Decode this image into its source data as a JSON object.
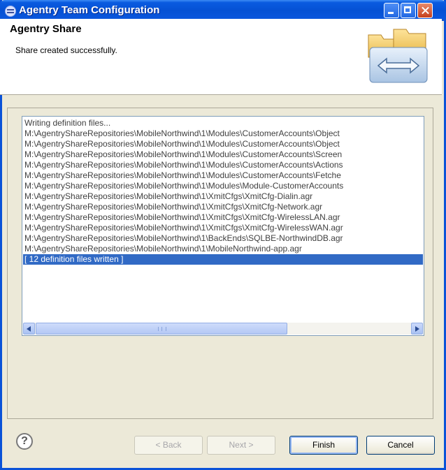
{
  "window": {
    "title": "Agentry Team Configuration"
  },
  "header": {
    "title": "Agentry Share",
    "message": "Share created successfully.",
    "banner_icon": "folders-transfer-icon"
  },
  "log": {
    "lines": [
      "Writing definition files...",
      "M:\\AgentryShareRepositories\\MobileNorthwind\\1\\Modules\\CustomerAccounts\\Object",
      "M:\\AgentryShareRepositories\\MobileNorthwind\\1\\Modules\\CustomerAccounts\\Object",
      "M:\\AgentryShareRepositories\\MobileNorthwind\\1\\Modules\\CustomerAccounts\\Screen",
      "M:\\AgentryShareRepositories\\MobileNorthwind\\1\\Modules\\CustomerAccounts\\Actions",
      "M:\\AgentryShareRepositories\\MobileNorthwind\\1\\Modules\\CustomerAccounts\\Fetche",
      "M:\\AgentryShareRepositories\\MobileNorthwind\\1\\Modules\\Module-CustomerAccounts",
      "M:\\AgentryShareRepositories\\MobileNorthwind\\1\\XmitCfgs\\XmitCfg-Dialin.agr",
      "M:\\AgentryShareRepositories\\MobileNorthwind\\1\\XmitCfgs\\XmitCfg-Network.agr",
      "M:\\AgentryShareRepositories\\MobileNorthwind\\1\\XmitCfgs\\XmitCfg-WirelessLAN.agr",
      "M:\\AgentryShareRepositories\\MobileNorthwind\\1\\XmitCfgs\\XmitCfg-WirelessWAN.agr",
      "M:\\AgentryShareRepositories\\MobileNorthwind\\1\\BackEnds\\SQLBE-NorthwindDB.agr",
      "M:\\AgentryShareRepositories\\MobileNorthwind\\1\\MobileNorthwind-app.agr"
    ],
    "summary": "[ 12 definition files written ]"
  },
  "buttons": {
    "help": "?",
    "back": "< Back",
    "next": "Next >",
    "finish": "Finish",
    "cancel": "Cancel"
  }
}
